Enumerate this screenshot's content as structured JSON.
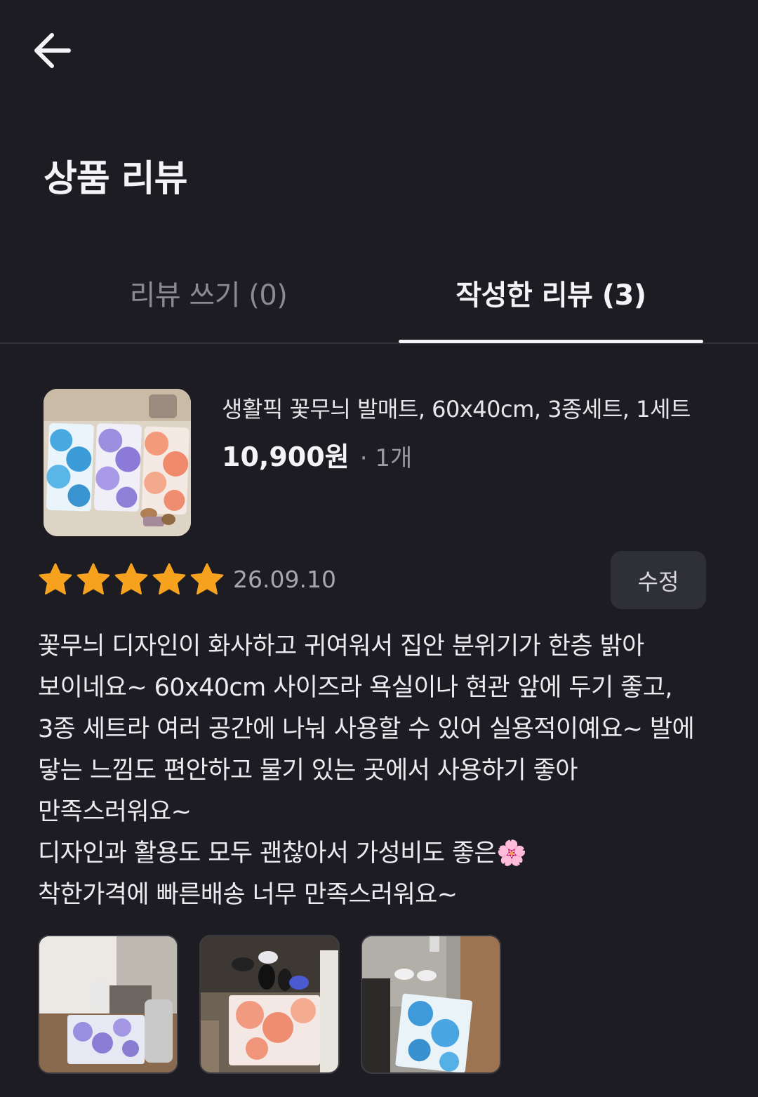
{
  "header": {
    "back_icon": "arrow-left-icon",
    "title": "상품 리뷰"
  },
  "tabs": [
    {
      "label": "리뷰 쓰기 (0)",
      "active": false
    },
    {
      "label": "작성한 리뷰 (3)",
      "active": true
    }
  ],
  "review": {
    "product": {
      "name": "생활픽 꽃무늬 발매트, 60x40cm, 3종세트, 1세트",
      "price": "10,900원",
      "quantity": "· 1개"
    },
    "rating": 5,
    "rating_max": 5,
    "date": "26.09.10",
    "edit_label": "수정",
    "lines": [
      "꽃무늬 디자인이 화사하고 귀여워서 집안 분위기가 한층 밝아",
      "보이네요~  60x40cm 사이즈라 욕실이나 현관 앞에 두기 좋고,",
      "3종 세트라 여러 공간에 나눠 사용할 수 있어 실용적이예요~ 발에",
      "닿는 느낌도 편안하고 물기 있는 곳에서 사용하기 좋아",
      "만족스러워요~",
      "디자인과 활용도 모두 괜찮아서 가성비도 좋은🌸",
      "착한가격에 빠른배송 너무 만족스러워요~"
    ],
    "photo_count": 3
  },
  "colors": {
    "background": "#1c1c22",
    "star": "#f6a21e",
    "edit_button_bg": "#2e2f37",
    "tab_indicator": "#f4f4f7"
  }
}
